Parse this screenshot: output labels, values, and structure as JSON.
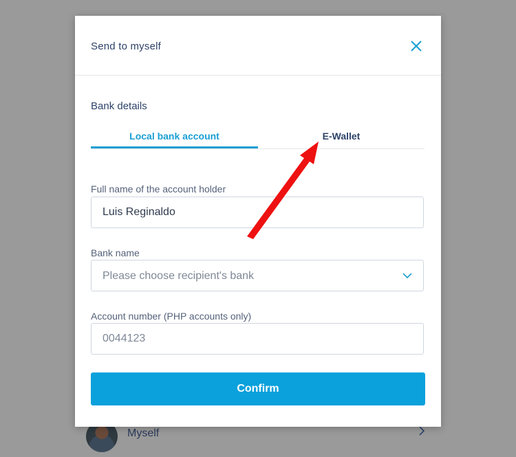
{
  "background": {
    "row_name": "Myself",
    "icons": {
      "avatar": "avatar",
      "chevron": "chevron-right-icon"
    }
  },
  "modal": {
    "title": "Send to myself",
    "close_icon": "close-icon",
    "section_label": "Bank details",
    "tabs": [
      {
        "label": "Local bank account",
        "active": true
      },
      {
        "label": "E-Wallet",
        "active": false
      }
    ],
    "fields": {
      "full_name": {
        "label": "Full name of the account holder",
        "value": "Luis Reginaldo",
        "placeholder": ""
      },
      "bank_name": {
        "label": "Bank name",
        "placeholder": "Please choose recipient's bank",
        "icon": "chevron-down-icon"
      },
      "account_number": {
        "label": "Account number (PHP accounts only)",
        "value": "",
        "placeholder": "0044123"
      }
    },
    "confirm_label": "Confirm"
  },
  "annotation": {
    "arrow_color": "#ee1111",
    "points_to": "E-Wallet tab"
  },
  "colors": {
    "accent": "#0aa1dc",
    "title": "#2e4369",
    "backdrop": "#9a9a9a"
  }
}
